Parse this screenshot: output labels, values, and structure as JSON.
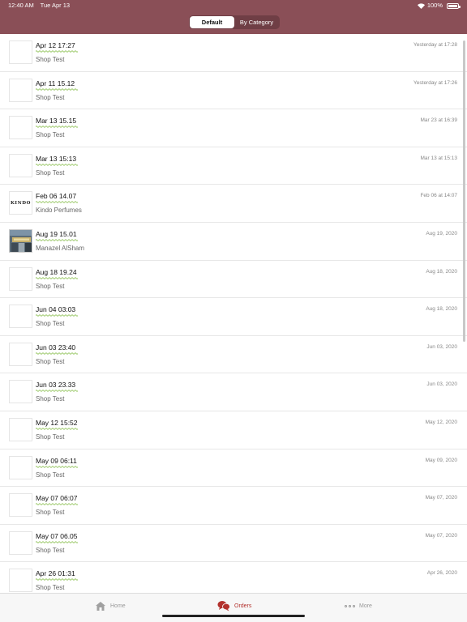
{
  "status_bar": {
    "time": "12:40 AM",
    "date": "Tue Apr 13",
    "battery": "100%",
    "wifi_icon": "wifi-icon",
    "battery_icon": "battery-icon"
  },
  "segment_control": {
    "default_label": "Default",
    "by_category_label": "By Category",
    "selected": "Default"
  },
  "orders": [
    {
      "title": "Apr 12 17:27",
      "shop": "Shop Test",
      "date": "Yesterday at 17:28",
      "thumb": "blank"
    },
    {
      "title": "Apr 11 15.12",
      "shop": "Shop Test",
      "date": "Yesterday at 17:26",
      "thumb": "blank"
    },
    {
      "title": "Mar 13 15.15",
      "shop": "Shop Test",
      "date": "Mar 23 at 16:39",
      "thumb": "blank"
    },
    {
      "title": "Mar 13 15:13",
      "shop": "Shop Test",
      "date": "Mar 13 at 15:13",
      "thumb": "blank"
    },
    {
      "title": "Feb 06 14.07",
      "shop": "Kindo Perfumes",
      "date": "Feb 06 at 14:07",
      "thumb": "kindo",
      "thumb_text": "KINDO"
    },
    {
      "title": "Aug 19 15.01",
      "shop": "Manazel AlSham",
      "date": "Aug 19, 2020",
      "thumb": "photo"
    },
    {
      "title": "Aug 18 19.24",
      "shop": "Shop Test",
      "date": "Aug 18, 2020",
      "thumb": "blank"
    },
    {
      "title": "Jun 04 03:03",
      "shop": "Shop Test",
      "date": "Aug 18, 2020",
      "thumb": "blank"
    },
    {
      "title": "Jun 03 23:40",
      "shop": "Shop Test",
      "date": "Jun 03, 2020",
      "thumb": "blank"
    },
    {
      "title": "Jun 03 23.33",
      "shop": "Shop Test",
      "date": "Jun 03, 2020",
      "thumb": "blank"
    },
    {
      "title": "May 12 15:52",
      "shop": "Shop Test",
      "date": "May 12, 2020",
      "thumb": "blank"
    },
    {
      "title": "May 09 06:11",
      "shop": "Shop Test",
      "date": "May 09, 2020",
      "thumb": "blank"
    },
    {
      "title": "May 07 06:07",
      "shop": "Shop Test",
      "date": "May 07, 2020",
      "thumb": "blank"
    },
    {
      "title": "May 07 06.05",
      "shop": "Shop Test",
      "date": "May 07, 2020",
      "thumb": "blank"
    },
    {
      "title": "Apr 26 01:31",
      "shop": "Shop Test",
      "date": "Apr 26, 2020",
      "thumb": "blank"
    }
  ],
  "tab_bar": {
    "home_label": "Home",
    "orders_label": "Orders",
    "more_label": "More",
    "selected": "Orders",
    "home_icon": "home-icon",
    "orders_icon": "chat-bubbles-icon",
    "more_icon": "ellipsis-icon"
  },
  "colors": {
    "header_bg": "#8a4f57",
    "active_tab": "#b3322e",
    "squiggle": "#7cb83a"
  }
}
